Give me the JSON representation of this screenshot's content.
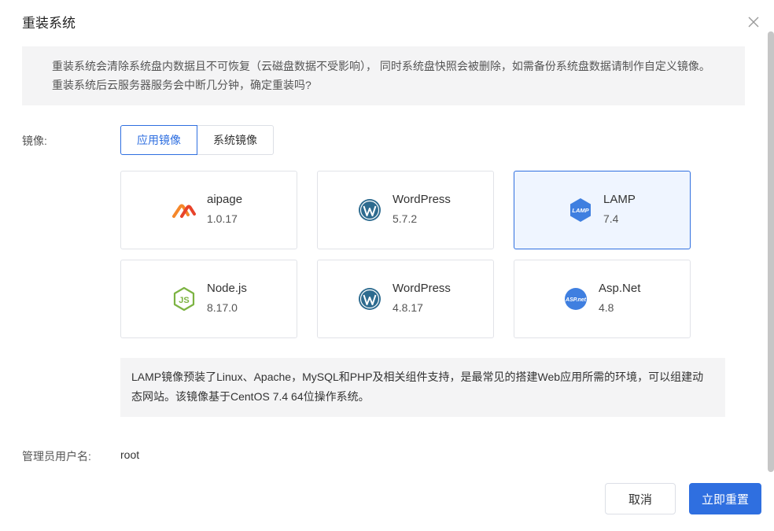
{
  "dialog": {
    "title": "重装系统",
    "close_icon": "close-icon"
  },
  "warning": {
    "text": "重装系统会清除系统盘内数据且不可恢复（云磁盘数据不受影响）， 同时系统盘快照会被删除，如需备份系统盘数据请制作自定义镜像。 重装系统后云服务器服务会中断几分钟，确定重装吗?"
  },
  "image_section": {
    "label": "镜像:",
    "tabs": [
      {
        "label": "应用镜像",
        "active": true
      },
      {
        "label": "系统镜像",
        "active": false
      }
    ],
    "cards": [
      {
        "name": "aipage",
        "version": "1.0.17",
        "icon": "aipage-logo-icon",
        "selected": false
      },
      {
        "name": "WordPress",
        "version": "5.7.2",
        "icon": "wordpress-logo-icon",
        "selected": false
      },
      {
        "name": "LAMP",
        "version": "7.4",
        "icon": "lamp-logo-icon",
        "icon_text": "LAMP",
        "selected": true
      },
      {
        "name": "Node.js",
        "version": "8.17.0",
        "icon": "nodejs-logo-icon",
        "icon_text": "JS",
        "selected": false
      },
      {
        "name": "WordPress",
        "version": "4.8.17",
        "icon": "wordpress-logo-icon",
        "selected": false
      },
      {
        "name": "Asp.Net",
        "version": "4.8",
        "icon": "aspnet-logo-icon",
        "icon_text": "ASP.net",
        "selected": false
      }
    ],
    "description": "LAMP镜像预装了Linux、Apache，MySQL和PHP及相关组件支持，是最常见的搭建Web应用所需的环境，可以组建动态网站。该镜像基于CentOS 7.4 64位操作系统。"
  },
  "admin": {
    "label": "管理员用户名:",
    "value": "root"
  },
  "buttons": {
    "cancel": "取消",
    "confirm": "立即重置"
  },
  "colors": {
    "primary": "#2f6fe0",
    "selected_bg": "#eff5ff",
    "panel_bg": "#f4f4f5",
    "wordpress": "#2d6b8f",
    "nodejs": "#7cb342",
    "lamp": "#3f7fe0",
    "aipage_orange": "#f5872a",
    "aipage_red": "#e8432a"
  }
}
